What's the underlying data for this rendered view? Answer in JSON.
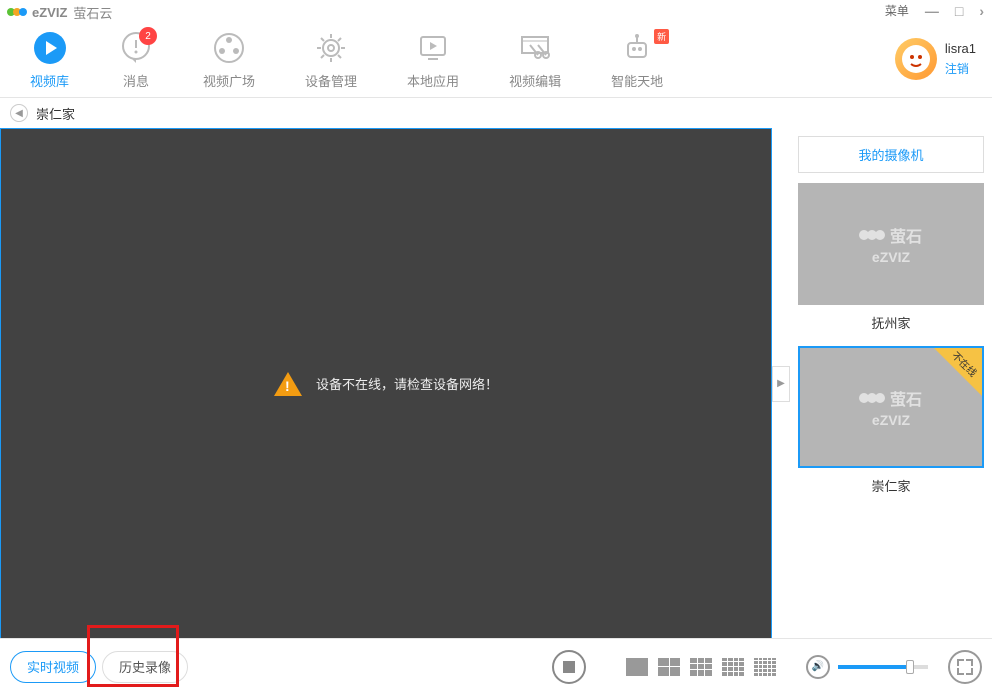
{
  "title": {
    "brand": "eZVIZ",
    "brand_cn": "萤石云",
    "menu": "菜单"
  },
  "toolbar": {
    "items": [
      {
        "label": "视频库"
      },
      {
        "label": "消息",
        "badge": "2"
      },
      {
        "label": "视频广场"
      },
      {
        "label": "设备管理"
      },
      {
        "label": "本地应用"
      },
      {
        "label": "视频编辑"
      },
      {
        "label": "智能天地",
        "new": "新"
      }
    ]
  },
  "user": {
    "name": "lisra1",
    "logout": "注销"
  },
  "breadcrumb": {
    "current": "崇仁家"
  },
  "video": {
    "offline_text": "设备不在线，请检查设备网络！"
  },
  "sidebar": {
    "header": "我的摄像机",
    "cameras": [
      {
        "name": "抚州家",
        "brand_cn": "萤石",
        "brand_en": "eZVIZ",
        "offline": false
      },
      {
        "name": "崇仁家",
        "brand_cn": "萤石",
        "brand_en": "eZVIZ",
        "offline": true,
        "offline_label": "不在线"
      }
    ]
  },
  "bottom": {
    "tab_live": "实时视频",
    "tab_history": "历史录像"
  }
}
